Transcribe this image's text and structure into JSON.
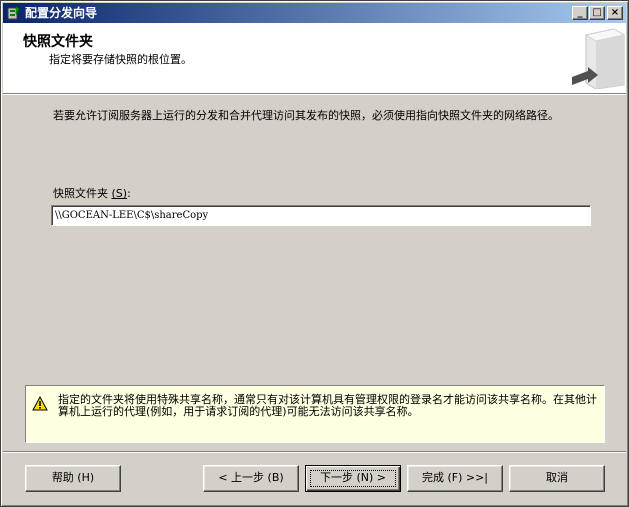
{
  "window": {
    "title": "配置分发向导",
    "minimize": "_",
    "maximize": "□",
    "close": "×"
  },
  "header": {
    "title": "快照文件夹",
    "subtitle": "指定将要存储快照的根位置。"
  },
  "content": {
    "intro": "若要允许订阅服务器上运行的分发和合并代理访问其发布的快照，必须使用指向快照文件夹的网络路径。",
    "field_label": "快照文件夹",
    "field_hotkey": "(S)",
    "field_colon": ":",
    "path_value": "\\\\GOCEAN-LEE\\C$\\shareCopy"
  },
  "warning": {
    "icon": "warning-icon",
    "text": "指定的文件夹将使用特殊共享名称，通常只有对该计算机具有管理权限的登录名才能访问该共享名称。在其他计算机上运行的代理(例如，用于请求订阅的代理)可能无法访问该共享名称。"
  },
  "buttons": {
    "help": "帮助 (H)",
    "back": "< 上一步 (B)",
    "next": "下一步 (N) >",
    "finish": "完成 (F) >>|",
    "cancel": "取消"
  }
}
